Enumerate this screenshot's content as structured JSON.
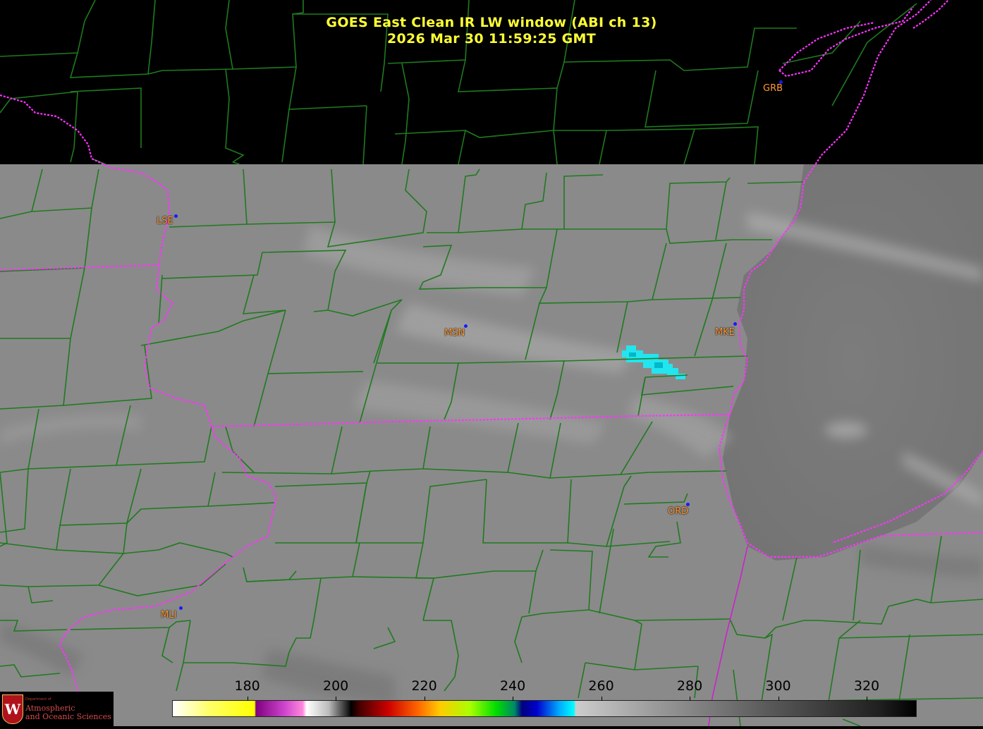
{
  "title": {
    "line1": "GOES East Clean IR LW window (ABI ch 13)",
    "line2": "2026 Mar 30  11:59:25 GMT"
  },
  "colors": {
    "background_no_data": "#000000",
    "county_lines": "#1f7a1f",
    "state_borders": "#ff33ff",
    "title_text": "#ffff33",
    "city_labels": "#ff9933",
    "city_markers": "#1a1aff",
    "cold_cloud_highlight": "#22e5f0"
  },
  "cities": [
    {
      "code": "GRB"
    },
    {
      "code": "LSE"
    },
    {
      "code": "MSN"
    },
    {
      "code": "MKE"
    },
    {
      "code": "ORD"
    },
    {
      "code": "MLI"
    }
  ],
  "colorbar": {
    "units": "",
    "range": [
      163,
      331
    ],
    "ticks": [
      "180",
      "200",
      "220",
      "240",
      "260",
      "280",
      "300",
      "320"
    ]
  },
  "logo": {
    "department_line": "Department of",
    "line1": "Atmospheric",
    "line2": "and Oceanic Sciences",
    "seal_letter": "W"
  }
}
